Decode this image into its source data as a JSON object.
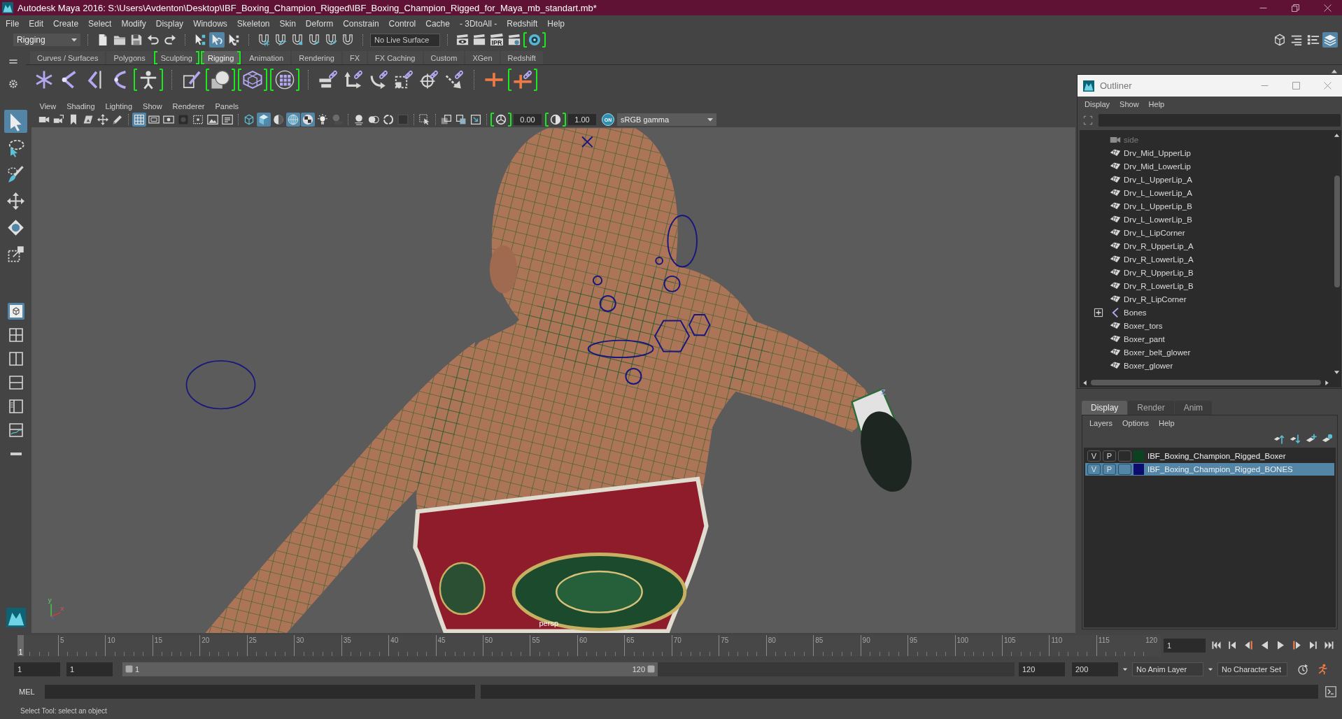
{
  "window": {
    "title": "Autodesk Maya 2016: S:\\Users\\Avdenton\\Desktop\\IBF_Boxing_Champion_Rigged\\IBF_Boxing_Champion_Rigged_for_Maya_mb_standart.mb*"
  },
  "menu_bar": [
    "File",
    "Edit",
    "Create",
    "Select",
    "Modify",
    "Display",
    "Windows",
    "Skeleton",
    "Skin",
    "Deform",
    "Constrain",
    "Control",
    "Cache",
    "- 3DtoAll -",
    "Redshift",
    "Help"
  ],
  "status_line": {
    "menu_set": "Rigging",
    "groups": [
      [
        {
          "kind": "file",
          "on": false
        },
        {
          "kind": "folder",
          "on": false
        },
        {
          "kind": "floppy",
          "on": false
        },
        {
          "kind": "undo",
          "on": false
        },
        {
          "kind": "redo",
          "on": false
        }
      ],
      [
        {
          "kind": "cursor-nodes",
          "on": false
        },
        {
          "kind": "cursor-hook",
          "on": true
        },
        {
          "kind": "cursor-squares",
          "on": false
        }
      ],
      [
        {
          "kind": "grid-magnet",
          "on": false
        },
        {
          "kind": "curve-magnet",
          "on": false
        },
        {
          "kind": "point-magnet",
          "on": false
        },
        {
          "kind": "plane-magnet",
          "on": false
        },
        {
          "kind": "surface-magnet",
          "on": false
        },
        {
          "kind": "magnet",
          "on": false
        }
      ]
    ],
    "live_surface": "No Live Surface",
    "render_icons": [
      {
        "kind": "clapper-eye",
        "on": false,
        "framed": false
      },
      {
        "kind": "clapper",
        "on": false,
        "framed": false
      },
      {
        "kind": "clapper",
        "label": "IPR",
        "on": false,
        "framed": false
      },
      {
        "kind": "clapper-gear",
        "on": false,
        "framed": false
      },
      {
        "kind": "lens",
        "on": false,
        "framed": true
      }
    ],
    "panel_toggles": [
      {
        "kind": "cube-wire",
        "on": false
      },
      {
        "kind": "list-lines",
        "on": false
      },
      {
        "kind": "list-dots",
        "on": false
      },
      {
        "kind": "layers",
        "on": true
      }
    ]
  },
  "shelf": {
    "tabs": [
      {
        "label": "Curves / Surfaces",
        "selected": false,
        "framed": false
      },
      {
        "label": "Polygons",
        "selected": false,
        "framed": false
      },
      {
        "label": "Sculpting",
        "selected": false,
        "framed": true
      },
      {
        "label": "Rigging",
        "selected": true,
        "framed": true
      },
      {
        "label": "Animation",
        "selected": false,
        "framed": false
      },
      {
        "label": "Rendering",
        "selected": false,
        "framed": false
      },
      {
        "label": "FX",
        "selected": false,
        "framed": false
      },
      {
        "label": "FX Caching",
        "selected": false,
        "framed": false
      },
      {
        "label": "Custom",
        "selected": false,
        "framed": false
      },
      {
        "label": "XGen",
        "selected": false,
        "framed": false
      },
      {
        "label": "Redshift",
        "selected": false,
        "framed": false
      }
    ],
    "groups": [
      [
        {
          "kind": "asterisk",
          "framed": false
        },
        {
          "kind": "joint-chain",
          "framed": false
        },
        {
          "kind": "joint-handle",
          "framed": false
        },
        {
          "kind": "curved-joint",
          "framed": false
        },
        {
          "kind": "skeleton-figure",
          "framed": true
        }
      ],
      [
        {
          "kind": "brush-box",
          "framed": false
        },
        {
          "kind": "sphere-box",
          "framed": true
        },
        {
          "kind": "lattice",
          "framed": true
        },
        {
          "kind": "dotted-grid",
          "framed": true
        }
      ],
      [
        {
          "kind": "bars-link",
          "framed": false
        },
        {
          "kind": "corner-arrow-link",
          "framed": false
        },
        {
          "kind": "curve-arrow-link",
          "framed": false
        },
        {
          "kind": "dashed-box-link",
          "framed": false
        },
        {
          "kind": "crosshair-link",
          "framed": false
        },
        {
          "kind": "diagonal-arrow-link",
          "framed": false
        }
      ],
      [
        {
          "kind": "cross-line",
          "framed": false
        },
        {
          "kind": "cross-link",
          "framed": true
        }
      ]
    ]
  },
  "toolbox": {
    "tools": [
      {
        "kind": "arrow-cursor",
        "selected": true
      },
      {
        "kind": "lasso",
        "selected": false
      },
      {
        "kind": "paint-brush",
        "selected": false
      },
      {
        "kind": "move-arrows",
        "selected": false
      },
      {
        "kind": "diamond",
        "selected": false
      },
      {
        "kind": "box-corner",
        "selected": false
      }
    ],
    "layouts": [
      {
        "kind": "single-view",
        "selected": true
      },
      {
        "kind": "quad-view",
        "selected": false
      },
      {
        "kind": "split-view",
        "selected": false
      },
      {
        "kind": "stacked-view",
        "selected": false
      },
      {
        "kind": "outliner-view",
        "selected": false
      },
      {
        "kind": "graph-view",
        "selected": false
      },
      {
        "kind": "collapse",
        "selected": false
      }
    ]
  },
  "viewport": {
    "menus": [
      "View",
      "Shading",
      "Lighting",
      "Show",
      "Renderer",
      "Panels"
    ],
    "toolbar_groups": [
      [
        {
          "kind": "camera",
          "on": false
        },
        {
          "kind": "camera-arrows",
          "on": false
        },
        {
          "kind": "bookmark",
          "on": false
        },
        {
          "kind": "image-plane",
          "on": false
        },
        {
          "kind": "move-arrows",
          "on": false
        },
        {
          "kind": "pencil",
          "on": false
        }
      ],
      [
        {
          "kind": "grid",
          "on": true
        },
        {
          "kind": "film",
          "on": false
        },
        {
          "kind": "frame-dot",
          "on": false
        },
        {
          "kind": "dark-square",
          "on": false
        },
        {
          "kind": "dashed-square",
          "on": false
        },
        {
          "kind": "picture",
          "on": false
        },
        {
          "kind": "text-lines",
          "on": false
        }
      ],
      [
        {
          "kind": "wire-cube",
          "on": false
        },
        {
          "kind": "shaded-cube",
          "on": true
        },
        {
          "kind": "half-circle",
          "on": false
        },
        {
          "kind": "wire-sphere",
          "on": true
        },
        {
          "kind": "checker",
          "on": true
        },
        {
          "kind": "bulb",
          "on": false
        },
        {
          "kind": "shadow",
          "on": false
        }
      ],
      [
        {
          "kind": "ball-lines",
          "on": false
        },
        {
          "kind": "two-circles",
          "on": false
        },
        {
          "kind": "ring",
          "on": false
        },
        {
          "kind": "dark-tile",
          "on": false
        }
      ],
      [
        {
          "kind": "select-region",
          "on": false
        }
      ],
      [
        {
          "kind": "stacked-squares",
          "on": false
        },
        {
          "kind": "overlap-squares",
          "on": false
        },
        {
          "kind": "corner-square",
          "on": false
        }
      ]
    ],
    "exposure": {
      "icon": {
        "kind": "aperture",
        "framed": true
      },
      "value": "0.00"
    },
    "gamma": {
      "icon": {
        "kind": "aperture-half",
        "framed": true
      },
      "value": "1.00"
    },
    "color_management": {
      "label": "ON",
      "on": true
    },
    "view_transform": "sRGB gamma",
    "camera_label": "persp",
    "view_axes": [
      "y",
      "x"
    ],
    "axis_label": "z"
  },
  "outliner": {
    "title": "Outliner",
    "menus": [
      "Display",
      "Show",
      "Help"
    ],
    "items": [
      {
        "label": "side",
        "kind": "camera",
        "dimmed": true
      },
      {
        "label": "Drv_Mid_UpperLip",
        "kind": "mesh",
        "dimmed": false
      },
      {
        "label": "Drv_Mid_LowerLip",
        "kind": "mesh",
        "dimmed": false
      },
      {
        "label": "Drv_L_UpperLip_A",
        "kind": "mesh",
        "dimmed": false
      },
      {
        "label": "Drv_L_LowerLip_A",
        "kind": "mesh",
        "dimmed": false
      },
      {
        "label": "Drv_L_UpperLip_B",
        "kind": "mesh",
        "dimmed": false
      },
      {
        "label": "Drv_L_LowerLip_B",
        "kind": "mesh",
        "dimmed": false
      },
      {
        "label": "Drv_L_LipCorner",
        "kind": "mesh",
        "dimmed": false
      },
      {
        "label": "Drv_R_UpperLip_A",
        "kind": "mesh",
        "dimmed": false
      },
      {
        "label": "Drv_R_LowerLip_A",
        "kind": "mesh",
        "dimmed": false
      },
      {
        "label": "Drv_R_UpperLip_B",
        "kind": "mesh",
        "dimmed": false
      },
      {
        "label": "Drv_R_LowerLip_B",
        "kind": "mesh",
        "dimmed": false
      },
      {
        "label": "Drv_R_LipCorner",
        "kind": "mesh",
        "dimmed": false
      },
      {
        "label": "Bones",
        "kind": "joint",
        "dimmed": false,
        "expanded": false
      },
      {
        "label": "Boxer_tors",
        "kind": "mesh",
        "dimmed": false
      },
      {
        "label": "Boxer_pant",
        "kind": "mesh",
        "dimmed": false
      },
      {
        "label": "Boxer_belt_glower",
        "kind": "mesh",
        "dimmed": false
      },
      {
        "label": "Boxer_glower",
        "kind": "mesh",
        "dimmed": false
      }
    ]
  },
  "layer_editor": {
    "tabs": [
      {
        "label": "Display",
        "selected": true
      },
      {
        "label": "Render",
        "selected": false
      },
      {
        "label": "Anim",
        "selected": false
      }
    ],
    "menus": [
      "Layers",
      "Options",
      "Help"
    ],
    "layers": [
      {
        "visibility": "V",
        "playback": "P",
        "name": "IBF_Boxing_Champion_Rigged_Boxer",
        "color": "#0b4220",
        "selected": false
      },
      {
        "visibility": "V",
        "playback": "P",
        "name": "IBF_Boxing_Champion_Rigged_BONES",
        "color": "#0c0c6e",
        "selected": true
      }
    ]
  },
  "time_slider": {
    "ticks": [
      "5",
      "10",
      "15",
      "20",
      "25",
      "30",
      "35",
      "40",
      "45",
      "50",
      "55",
      "60",
      "65",
      "70",
      "75",
      "80",
      "85",
      "90",
      "95",
      "100",
      "105",
      "110",
      "115",
      "120"
    ],
    "current_frame": "1",
    "level": 0,
    "frame_field": "1"
  },
  "range_slider": {
    "start_time": "1",
    "playback_start": "1",
    "range_start": "1",
    "range_end": "120",
    "level": 0.6,
    "playback_end": "120",
    "end_time": "200",
    "anim_layer": "No Anim Layer",
    "character_set": "No Character Set"
  },
  "command_line": {
    "language": "MEL"
  },
  "help_line": "Select Tool: select an object"
}
